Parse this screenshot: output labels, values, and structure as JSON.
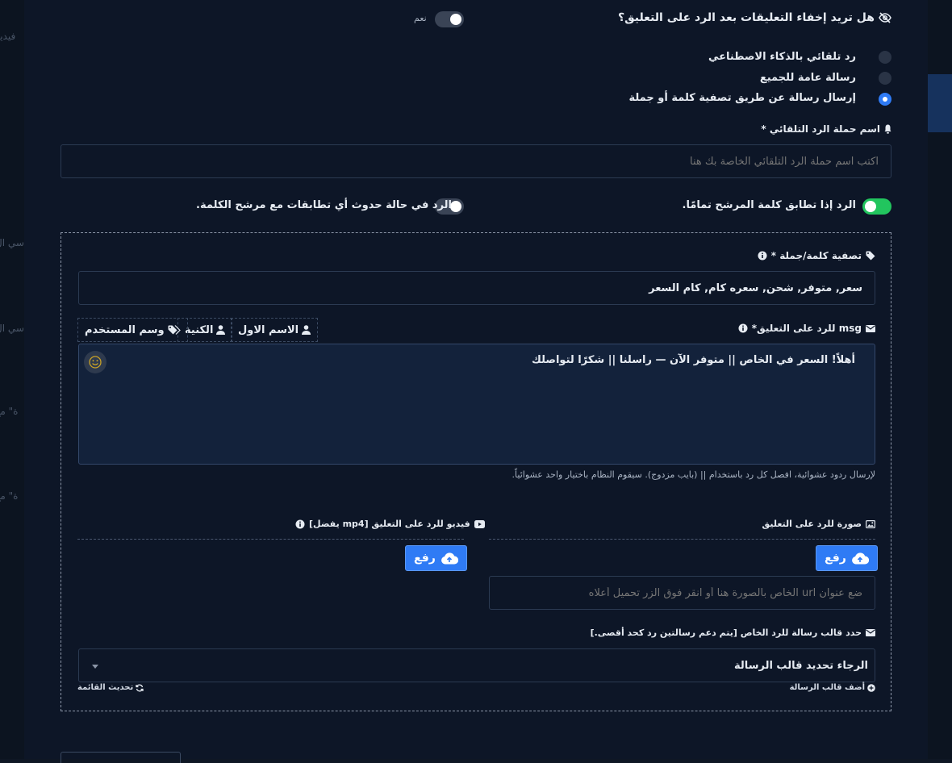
{
  "background": {
    "ghost_texts": [
      "فيديو",
      "اسي ال",
      "اسي ال",
      "ة\" مع",
      "ة\" مع"
    ]
  },
  "hide_comments": {
    "label": "هل تريد إخفاء التعليقات بعد الرد على التعليق؟",
    "toggle_text": "نعم"
  },
  "reply_types": [
    {
      "label": "رد تلقائي بالذكاء الاصطناعي",
      "selected": false
    },
    {
      "label": "رسالة عامة للجميع",
      "selected": false
    },
    {
      "label": "إرسال رسالة عن طريق تصفية كلمة أو جملة",
      "selected": true
    }
  ],
  "campaign_name": {
    "label": "اسم حملة الرد التلقائي *",
    "placeholder": "اكتب اسم حملة الرد التلقائي الخاصة بك هنا"
  },
  "match_options": {
    "exact_label": "الرد إذا تطابق كلمة المرشح تمامًا.",
    "partial_label": "الرد في حالة حدوث أي تطابقات مع مرشح الكلمة."
  },
  "filter": {
    "label": "تصفية كلمة/جملة *",
    "value": "سعر, متوفر, شحن, سعره كام, كام السعر"
  },
  "message": {
    "label": "msg للرد على التعليق*",
    "tags": [
      {
        "label": "الاسم الاول",
        "icon": "user-icon"
      },
      {
        "label": "الكنية",
        "icon": "user-icon"
      },
      {
        "label": "وسم المستخدم",
        "icon": "tags-icon"
      }
    ],
    "value": "أهلاً! السعر في الخاص || متوفر الآن — راسلنا || شكرًا لتواصلك",
    "hint": "لإرسال ردود عشوائية، افصل كل رد باستخدام || (بايب مزدوج). سيقوم النظام باختيار واحد عشوائياً."
  },
  "image_reply": {
    "label": "صورة للرد على التعليق",
    "upload_label": "رفع",
    "url_placeholder": "ضع عنوان url الخاص بالصورة هنا أو انقر فوق الزر تحميل أعلاه"
  },
  "video_reply": {
    "label": "فيديو للرد على التعليق [mp4 يفضل]",
    "upload_label": "رفع"
  },
  "template": {
    "label": "حدد قالب رسالة للرد الخاص [يتم دعم رسالتين رد كحد أقصى.]",
    "selected": "الرجاء تحديد قالب الرسالة",
    "add_label": "أضف قالب الرسالة",
    "refresh_label": "تحديث القائمة"
  },
  "colors": {
    "accent": "#2f7bf5",
    "toggle_on": "#22c55e",
    "panel": "#0d1627"
  }
}
